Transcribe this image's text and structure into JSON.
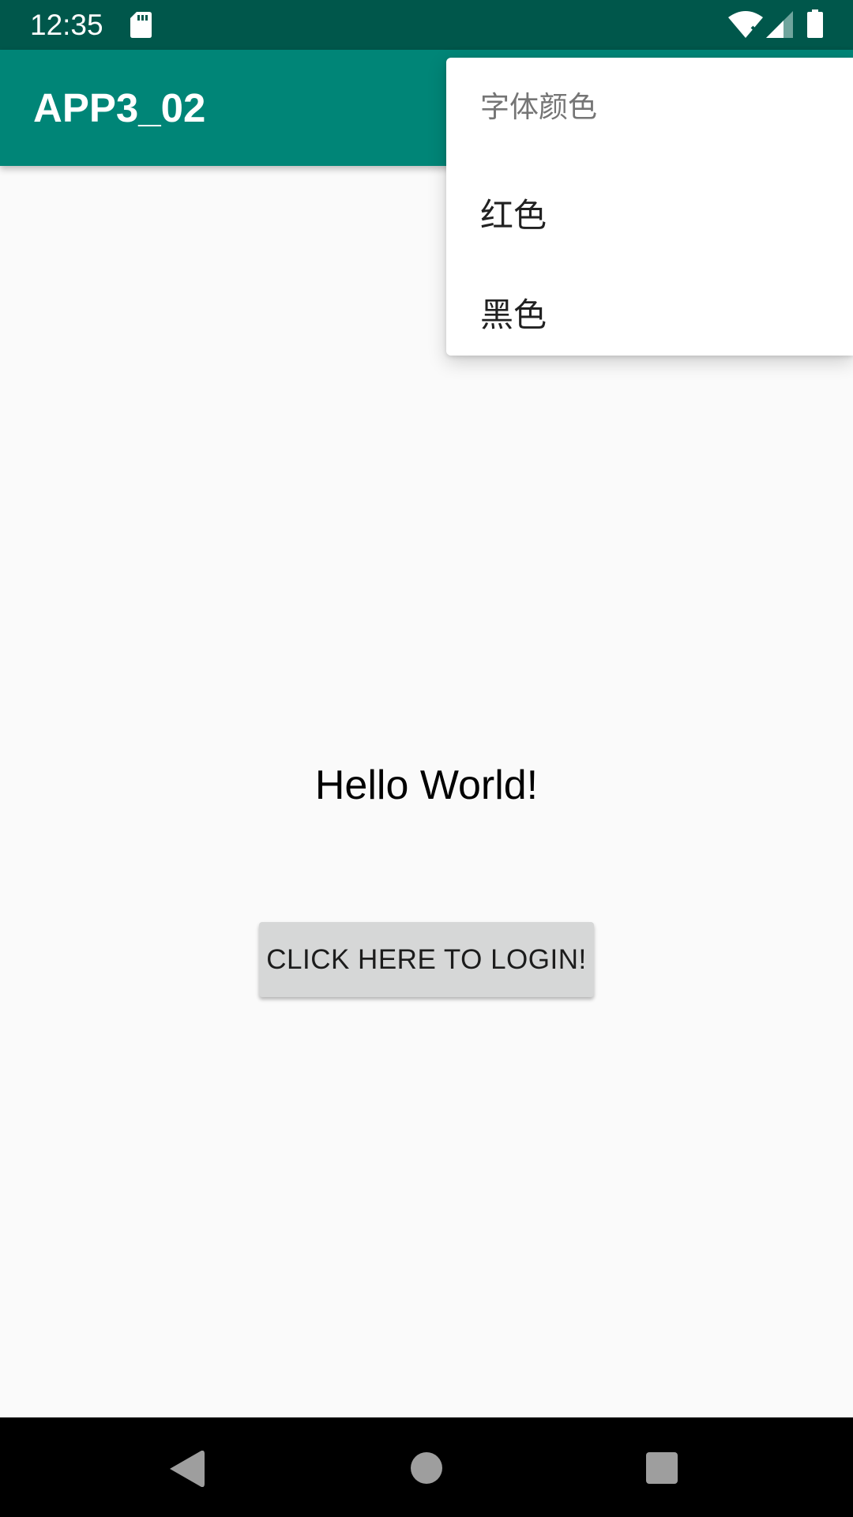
{
  "status_bar": {
    "time": "12:35",
    "icons": [
      "sd-card-icon",
      "wifi-icon",
      "cell-signal-icon",
      "battery-icon"
    ],
    "background": "#00574b"
  },
  "app_bar": {
    "title": "APP3_02",
    "background": "#008577"
  },
  "content": {
    "hello_text": "Hello World!",
    "login_button_label": "CLICK HERE TO LOGIN!"
  },
  "popup_menu": {
    "header": "字体颜色",
    "items": [
      {
        "label": "红色"
      },
      {
        "label": "黑色"
      }
    ]
  },
  "nav_bar": {
    "buttons": [
      "back-icon",
      "home-icon",
      "recents-icon"
    ]
  }
}
